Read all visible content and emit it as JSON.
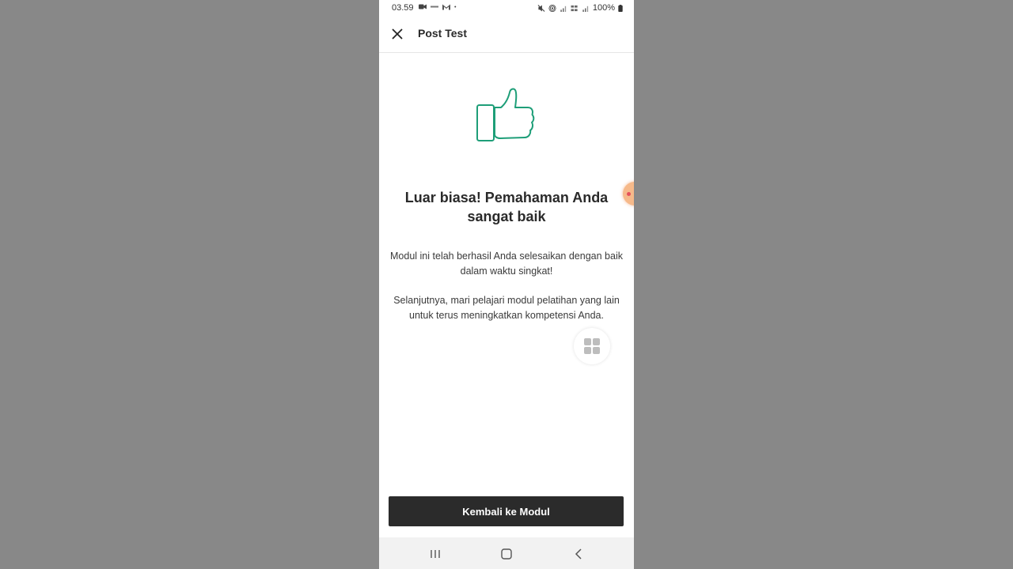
{
  "status_bar": {
    "time": "03.59",
    "battery": "100%",
    "left_icons": [
      "video-record-icon",
      "data-indicator-icon",
      "gmail-icon",
      "dot-icon"
    ],
    "right_icons": [
      "mute-icon",
      "hotspot-icon",
      "signal-icon",
      "4g-icon",
      "signal-icon"
    ]
  },
  "app_bar": {
    "title": "Post Test",
    "close_icon": "close-icon"
  },
  "content": {
    "illustration": "thumbs-up-icon",
    "headline": "Luar biasa! Pemahaman Anda sangat baik",
    "paragraph1": "Modul ini telah berhasil Anda selesaikan dengan baik dalam waktu singkat!",
    "paragraph2": "Selanjutnya, mari pelajari modul pelatihan yang lain untuk terus meningkatkan kompetensi Anda."
  },
  "floating": {
    "grid_button_icon": "grid-icon",
    "bubble_icon": "floating-bubble-icon"
  },
  "primary_button": {
    "label": "Kembali ke Modul"
  },
  "nav_bar": {
    "items": [
      "recent-apps-icon",
      "home-icon",
      "back-icon"
    ]
  },
  "colors": {
    "accent_green": "#1e9e78",
    "button_dark": "#2b2b2b",
    "backdrop": "#888888"
  }
}
